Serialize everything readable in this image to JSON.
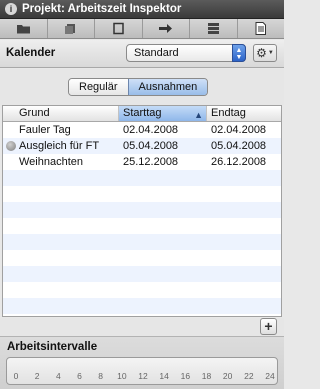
{
  "window": {
    "title": "Projekt: Arbeitszeit Inspektor",
    "title_icon": "i"
  },
  "toolbar": {
    "buttons": [
      "folder-icon",
      "stack-icon",
      "square-icon",
      "arrow-icon",
      "list-icon",
      "document-icon"
    ]
  },
  "calendar": {
    "label": "Kalender",
    "selected": "Standard",
    "gear": "⚙"
  },
  "tabs": {
    "items": [
      "Regulär",
      "Ausnahmen"
    ],
    "active": "Ausnahmen"
  },
  "table": {
    "columns": {
      "grund": "Grund",
      "starttag": "Starttag",
      "endtag": "Endtag"
    },
    "sorted_column": "Starttag",
    "rows": [
      {
        "grund": "Fauler Tag",
        "starttag": "02.04.2008",
        "endtag": "02.04.2008",
        "icon": false
      },
      {
        "grund": "Ausgleich für FT",
        "starttag": "05.04.2008",
        "endtag": "05.04.2008",
        "icon": true
      },
      {
        "grund": "Weihnachten",
        "starttag": "25.12.2008",
        "endtag": "26.12.2008",
        "icon": false
      }
    ],
    "empty_rows": 9
  },
  "add_button": "+",
  "intervals": {
    "label": "Arbeitsintervalle",
    "ticks": [
      "0",
      "2",
      "4",
      "6",
      "8",
      "10",
      "12",
      "14",
      "16",
      "18",
      "20",
      "22",
      "24"
    ]
  }
}
